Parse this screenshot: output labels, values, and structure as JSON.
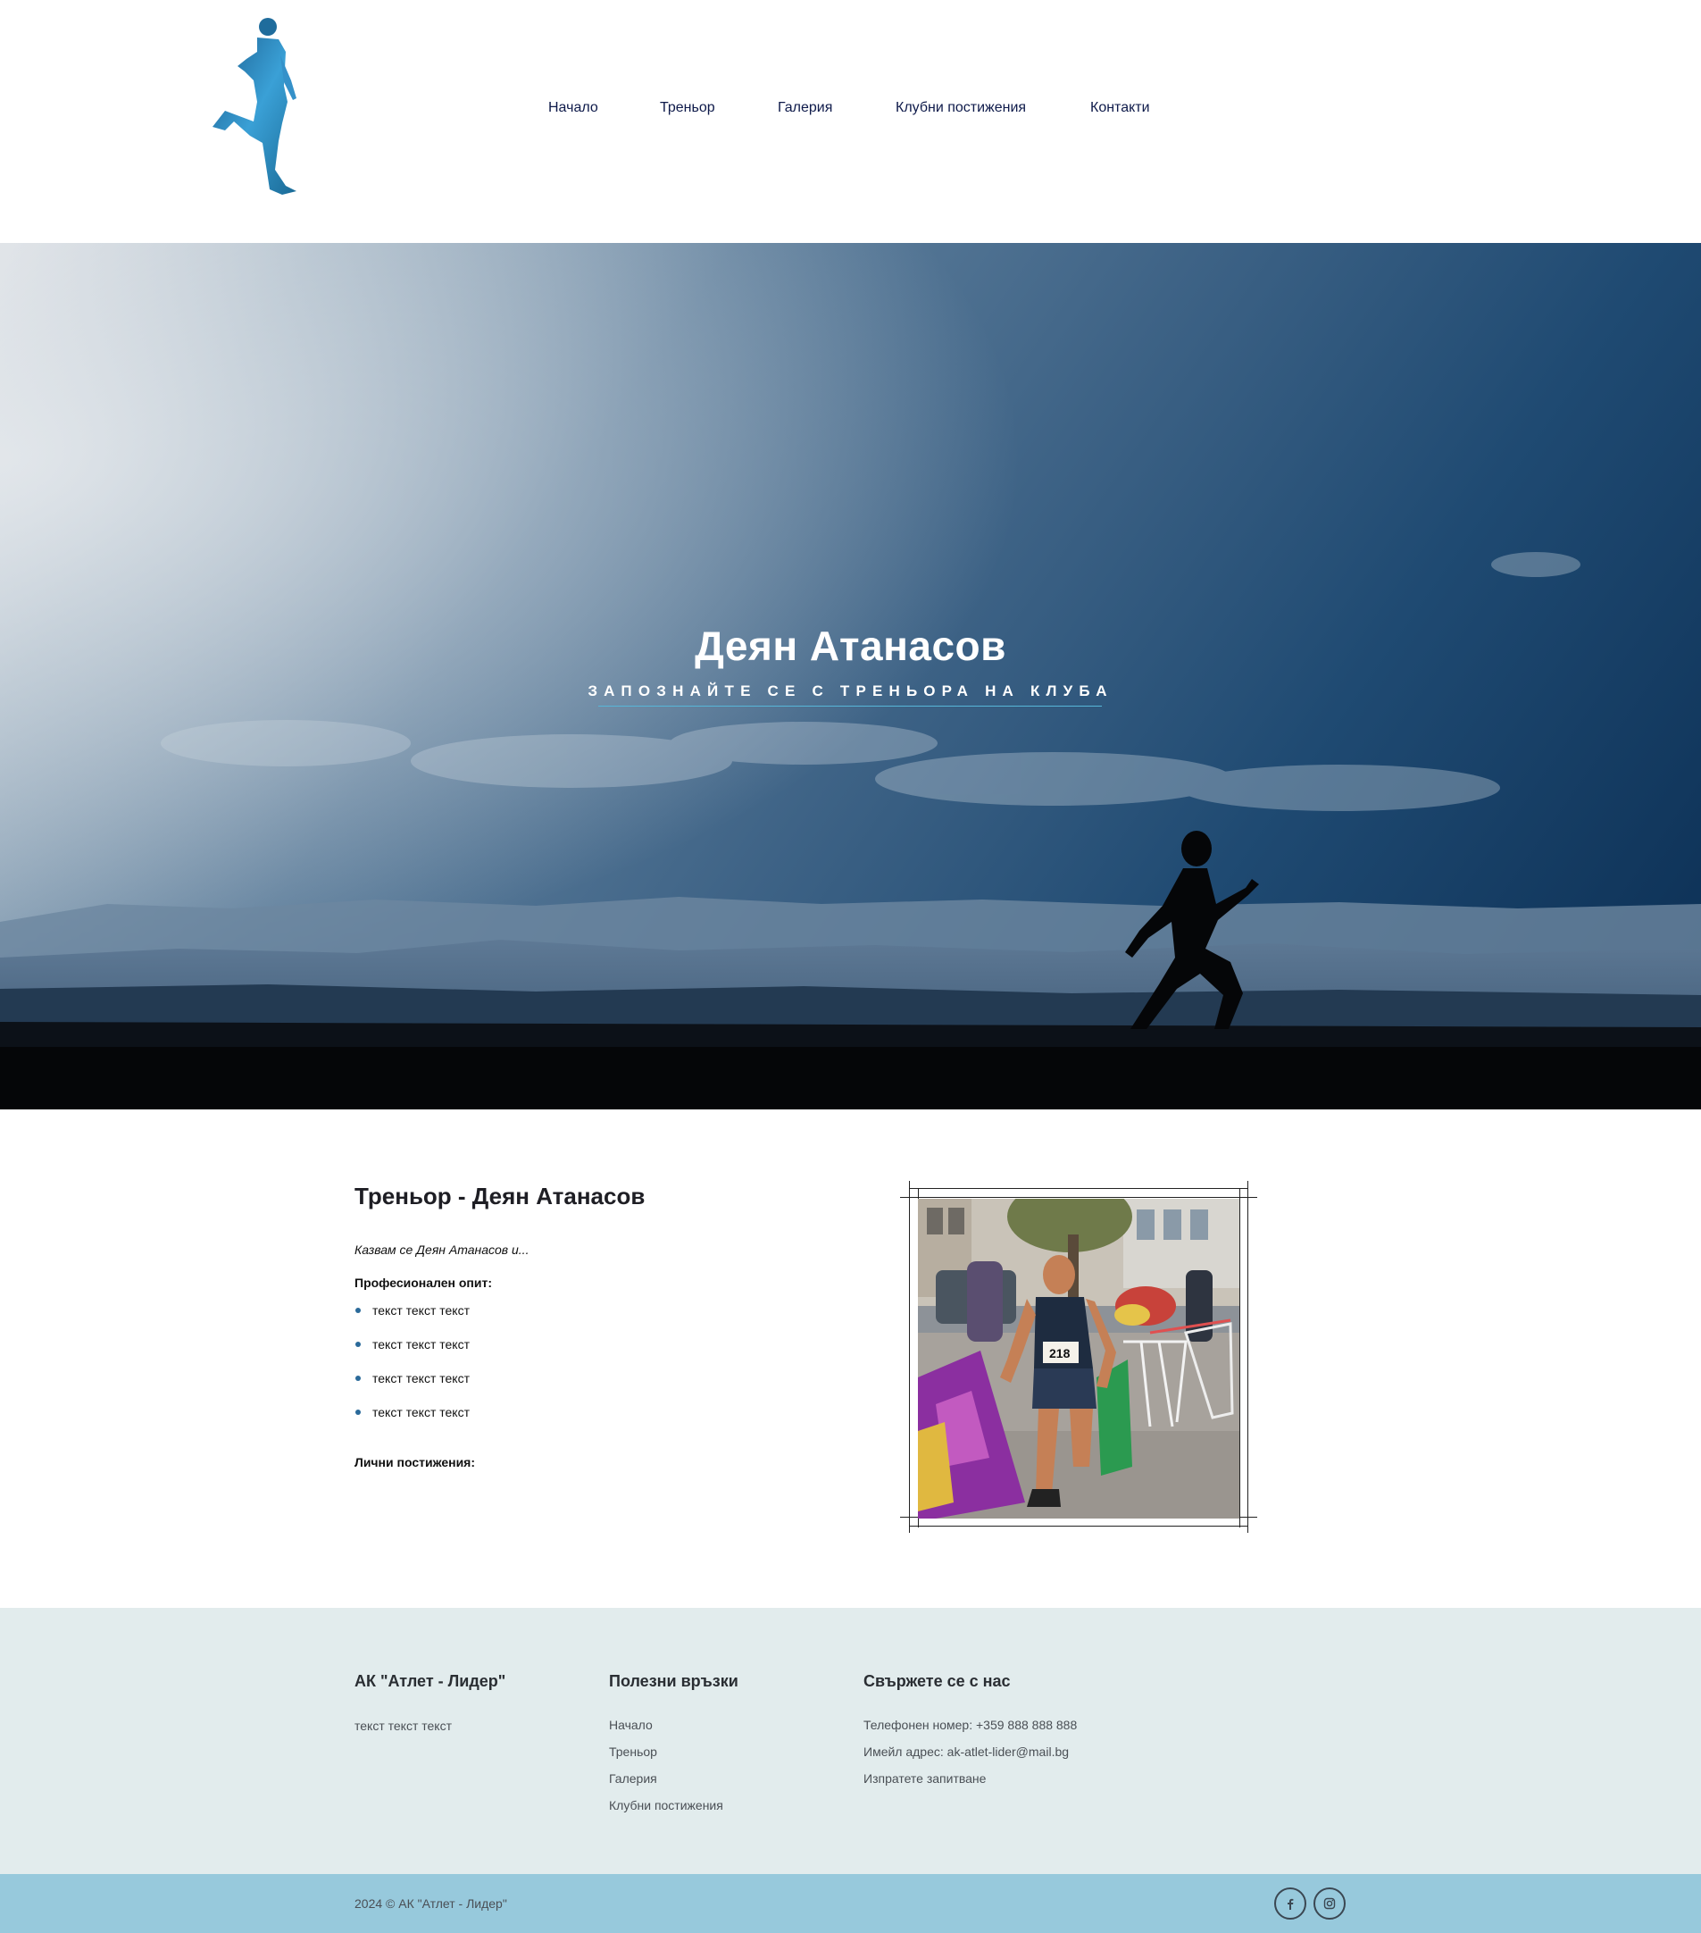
{
  "nav": {
    "items": [
      {
        "label": "Начало"
      },
      {
        "label": "Треньор"
      },
      {
        "label": "Галерия"
      },
      {
        "label": "Клубни постижения"
      },
      {
        "label": "Контакти"
      }
    ]
  },
  "hero": {
    "title": "Деян Атанасов",
    "subtitle": "ЗАПОЗНАЙТЕ СЕ С ТРЕНЬОРА НА КЛУБА"
  },
  "coach": {
    "title": "Треньор - Деян Атанасов",
    "intro": "Казвам се Деян Атанасов и...",
    "experience_label": "Професионален опит:",
    "experience_items": [
      "текст текст текст",
      "текст текст текст",
      "текст текст текст",
      "текст текст текст"
    ],
    "achievements_label": "Лични постижения:",
    "photo_bib": "218"
  },
  "footer": {
    "club": {
      "title": "АК \"Атлет - Лидер\"",
      "text": "текст текст текст"
    },
    "links": {
      "title": "Полезни връзки",
      "items": [
        "Начало",
        "Треньор",
        "Галерия",
        "Клубни постижения"
      ]
    },
    "contact": {
      "title": "Свържете се с нас",
      "phone": "Телефонен номер: +359 888 888 888",
      "email": "Имейл адрес: ak-atlet-lider@mail.bg",
      "inquiry": "Изпратете запитване"
    },
    "copyright": "2024 © АК \"Атлет - Лидер\"",
    "social": [
      {
        "icon": "facebook-icon"
      },
      {
        "icon": "instagram-icon"
      }
    ]
  },
  "colors": {
    "nav_text": "#0e1a4a",
    "accent_line": "#57b6d8",
    "footer_bg": "#e2eced",
    "bottom_bar_bg": "#97c9dc"
  }
}
